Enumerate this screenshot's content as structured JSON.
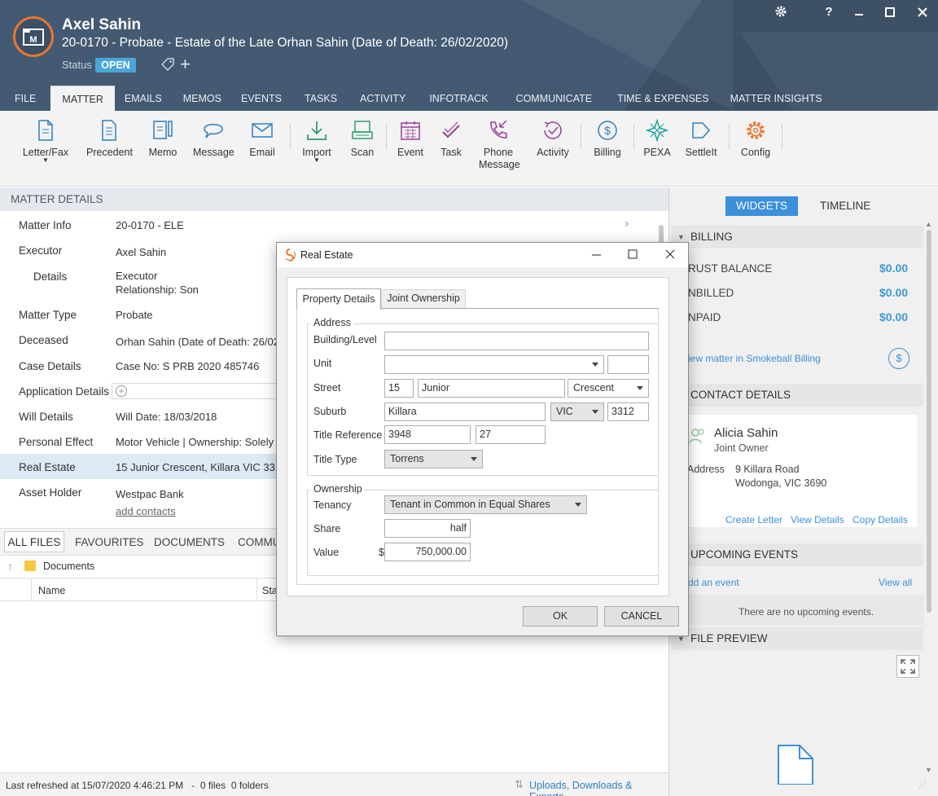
{
  "header": {
    "client_name": "Axel Sahin",
    "matter_title": "20-0170 - Probate - Estate of the Late Orhan Sahin (Date of Death: 26/02/2020)",
    "status_label": "Status",
    "status_value": "OPEN",
    "window_controls": [
      "gear-icon",
      "help-icon",
      "minimize-icon",
      "maximize-icon",
      "close-icon"
    ],
    "help_symbol": "?",
    "add_symbol": "+"
  },
  "tabs": [
    "FILE",
    "MATTER",
    "EMAILS",
    "MEMOS",
    "EVENTS",
    "TASKS",
    "ACTIVITY",
    "INFOTRACK",
    "COMMUNICATE",
    "TIME & EXPENSES",
    "MATTER INSIGHTS"
  ],
  "active_tab": "MATTER",
  "toolbar": {
    "items": [
      {
        "label": "Letter/Fax",
        "icon": "letter-icon"
      },
      {
        "label": "Precedent",
        "icon": "precedent-icon"
      },
      {
        "label": "Memo",
        "icon": "memo-icon"
      },
      {
        "label": "Message",
        "icon": "message-icon"
      },
      {
        "label": "Email",
        "icon": "email-icon"
      },
      {
        "label": "Import",
        "icon": "import-icon"
      },
      {
        "label": "Scan",
        "icon": "scan-icon"
      },
      {
        "label": "Event",
        "icon": "calendar-icon"
      },
      {
        "label": "Task",
        "icon": "task-icon"
      },
      {
        "label": "Phone",
        "label2": "Message",
        "icon": "phone-icon"
      },
      {
        "label": "Activity",
        "icon": "activity-icon"
      },
      {
        "label": "Billing",
        "icon": "billing-icon"
      },
      {
        "label": "PEXA",
        "icon": "pexa-icon"
      },
      {
        "label": "SettleIt",
        "icon": "settleit-icon"
      },
      {
        "label": "Config",
        "icon": "gear-icon"
      }
    ],
    "colors": {
      "blue": "#2e7fc1",
      "green": "#2e9b6d",
      "purple": "#9b3d9b",
      "teal": "#1aa39a",
      "orange": "#e8762d"
    }
  },
  "matter_details": {
    "heading": "MATTER DETAILS",
    "rows": [
      {
        "label": "Matter Info",
        "value": "20-0170 - ELE"
      },
      {
        "label": "Executor",
        "value": "Axel Sahin"
      },
      {
        "label": "Details",
        "value": "Executor",
        "value2": "Relationship: Son"
      },
      {
        "label": "Matter Type",
        "value": "Probate"
      },
      {
        "label": "Deceased",
        "value": "Orhan Sahin (Date of Death: 26/02"
      },
      {
        "label": "Case Details",
        "value": "Case No: S PRB 2020 485746"
      },
      {
        "label": "Application Details",
        "value": ""
      },
      {
        "label": "Will Details",
        "value": "Will Date: 18/03/2018"
      },
      {
        "label": "Personal Effect",
        "value": "Motor Vehicle | Ownership: Solely |"
      },
      {
        "label": "Real Estate",
        "value": "15 Junior Crescent, Killara VIC 3312"
      },
      {
        "label": "Asset Holder",
        "value": "Westpac Bank"
      }
    ],
    "add_contacts": "add contacts"
  },
  "files": {
    "tabs": [
      "ALL FILES",
      "FAVOURITES",
      "DOCUMENTS",
      "COMMU"
    ],
    "breadcrumb": "Documents",
    "columns": [
      "Name",
      "Sta"
    ],
    "status_bar": "Last refreshed at 15/07/2020 4:46:21 PM   -  0 files  0 folders",
    "uploads_link": "Uploads, Downloads & Exports"
  },
  "right_panel": {
    "tabs": [
      "WIDGETS",
      "TIMELINE"
    ],
    "billing": {
      "heading": "BILLING",
      "rows": [
        {
          "label": "RUST BALANCE",
          "value": "$0.00"
        },
        {
          "label": "NBILLED",
          "value": "$0.00"
        },
        {
          "label": "NPAID",
          "value": "$0.00"
        }
      ],
      "link": "iew matter in Smokeball Billing"
    },
    "contact": {
      "heading": "CONTACT DETAILS",
      "name": "Alicia Sahin",
      "role": "Joint Owner",
      "address_label": "Address",
      "address1": "9 Killara Road",
      "address2": "Wodonga, VIC 3690",
      "actions": [
        "Create Letter",
        "View Details",
        "Copy Details"
      ]
    },
    "events": {
      "heading": "UPCOMING EVENTS",
      "add": "dd an event",
      "view_all": "View all",
      "empty": "There are no upcoming events."
    },
    "preview": {
      "heading": "FILE PREVIEW"
    }
  },
  "dialog": {
    "title": "Real Estate",
    "tabs": [
      "Property Details",
      "Joint Ownership"
    ],
    "address": {
      "group_title": "Address",
      "building_label": "Building/Level",
      "building_value": "",
      "unit_label": "Unit",
      "unit_value": "",
      "unit_number": "",
      "street_label": "Street",
      "street_number": "15",
      "street_name": "Junior",
      "street_type": "Crescent",
      "suburb_label": "Suburb",
      "suburb": "Killara",
      "state": "VIC",
      "postcode": "3312",
      "title_ref_label": "Title Reference",
      "title_ref1": "3948",
      "title_ref2": "27",
      "title_type_label": "Title Type",
      "title_type": "Torrens"
    },
    "ownership": {
      "group_title": "Ownership",
      "tenancy_label": "Tenancy",
      "tenancy": "Tenant in Common in Equal Shares",
      "share_label": "Share",
      "share": "half",
      "value_label": "Value",
      "currency": "$",
      "value": "750,000.00"
    },
    "ok": "OK",
    "cancel": "CANCEL"
  }
}
